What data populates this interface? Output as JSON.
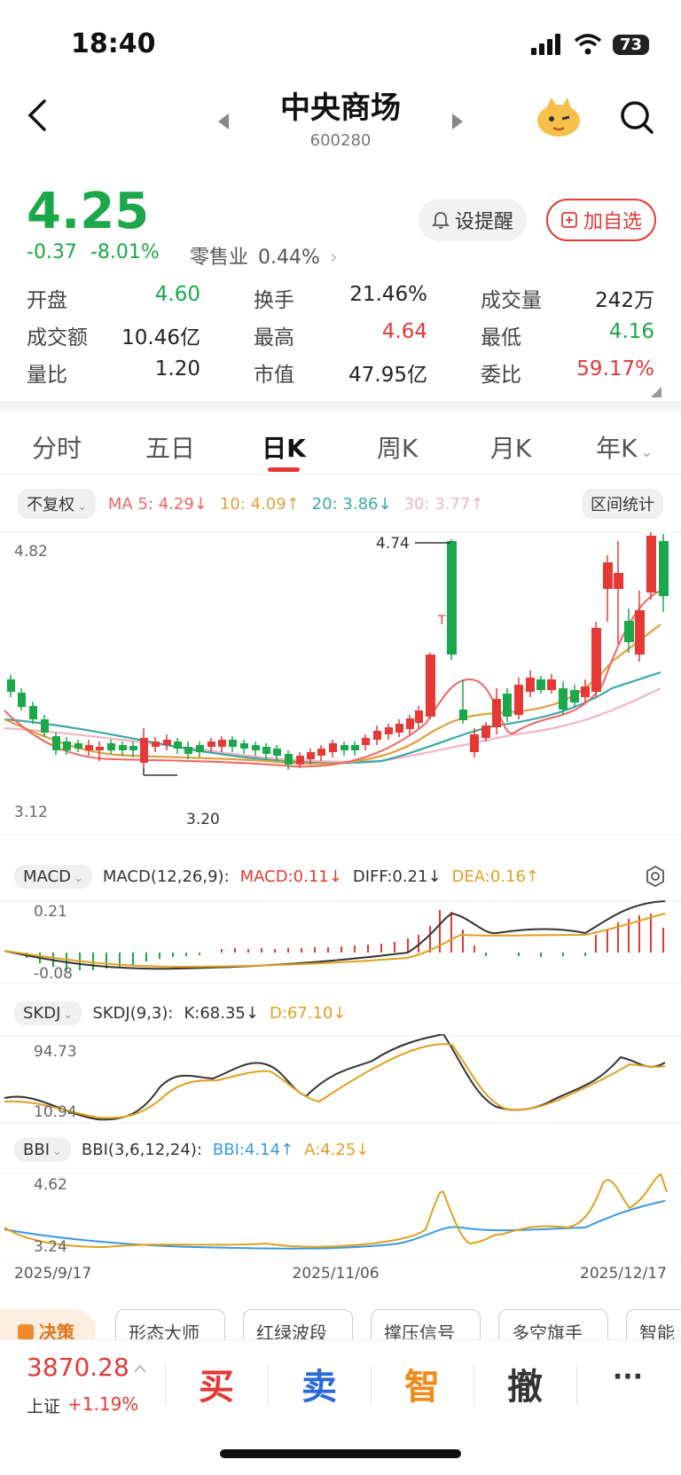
{
  "status": {
    "time": "18:40",
    "battery": "73"
  },
  "header": {
    "title": "中央商场",
    "code": "600280"
  },
  "quote": {
    "price": "4.25",
    "change": "-0.37",
    "change_pct": "-8.01%",
    "industry": "零售业",
    "industry_pct": "0.44%",
    "remind_label": "设提醒",
    "add_label": "加自选"
  },
  "stats": [
    [
      {
        "label": "开盘",
        "value": "4.60",
        "color": "green"
      },
      {
        "label": "换手",
        "value": "21.46%",
        "color": "dark"
      },
      {
        "label": "成交量",
        "value": "242万",
        "color": "dark"
      }
    ],
    [
      {
        "label": "成交额",
        "value": "10.46亿",
        "color": "dark"
      },
      {
        "label": "最高",
        "value": "4.64",
        "color": "red"
      },
      {
        "label": "最低",
        "value": "4.16",
        "color": "green"
      }
    ],
    [
      {
        "label": "量比",
        "value": "1.20",
        "color": "dark"
      },
      {
        "label": "市值",
        "value": "47.95亿",
        "color": "dark"
      },
      {
        "label": "委比",
        "value": "59.17%",
        "color": "red"
      }
    ]
  ],
  "tabs": [
    "分时",
    "五日",
    "日K",
    "周K",
    "月K",
    "年K"
  ],
  "ma": {
    "adjust": "不复权",
    "ma5": "MA 5: 4.29↓",
    "ma10": "10: 4.09↑",
    "ma20": "20: 3.86↓",
    "ma30": "30: 3.77↑",
    "range_stats": "区间统计",
    "colors": {
      "ma5": "#f06464",
      "ma10": "#e0a040",
      "ma20": "#3aa8a8",
      "ma30": "#f4b4c4"
    }
  },
  "main_chart": {
    "y_top": "4.82",
    "y_bottom": "3.12",
    "high_mark": "4.74",
    "low_mark": "3.20"
  },
  "macd": {
    "name": "MACD",
    "params": "MACD(12,26,9):",
    "macd": "MACD:0.11↓",
    "diff": "DIFF:0.21↓",
    "dea": "DEA:0.16↑",
    "y_top": "0.21",
    "y_bottom": "-0.08"
  },
  "skdj": {
    "name": "SKDJ",
    "params": "SKDJ(9,3):",
    "k": "K:68.35↓",
    "d": "D:67.10↓",
    "y_top": "94.73",
    "y_bottom": "10.94"
  },
  "bbi": {
    "name": "BBI",
    "params": "BBI(3,6,12,24):",
    "bbi": "BBI:4.14↑",
    "a": "A:4.25↓",
    "y_top": "4.62",
    "y_bottom": "3.24"
  },
  "dates": [
    "2025/9/17",
    "2025/11/06",
    "2025/12/17"
  ],
  "strategy": [
    "决策",
    "形态大师",
    "红绿波段",
    "撑压信号",
    "多空旗手",
    "智能"
  ],
  "bottom": {
    "index_value": "3870.28",
    "index_name": "上证",
    "index_change": "+1.19%",
    "buy": "买",
    "sell": "卖",
    "smart": "智",
    "cancel": "撤",
    "more": "···"
  }
}
